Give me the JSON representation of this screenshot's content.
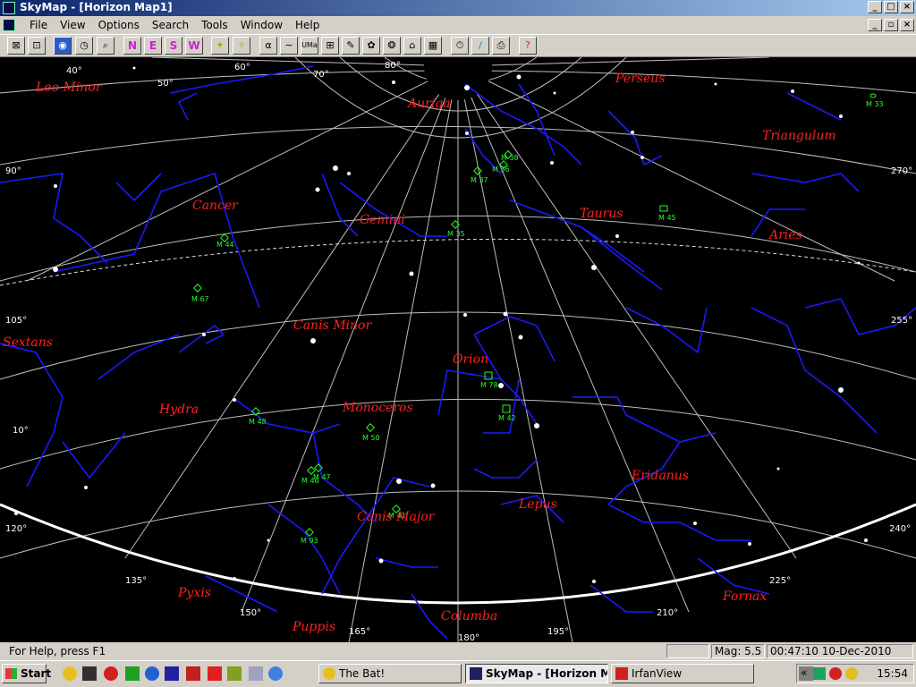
{
  "window": {
    "title": "SkyMap - [Horizon Map1]"
  },
  "menu": [
    "File",
    "View",
    "Options",
    "Search",
    "Tools",
    "Window",
    "Help"
  ],
  "toolbar": {
    "directions": [
      "N",
      "E",
      "S",
      "W"
    ],
    "alpha": "α",
    "umi": "UMa"
  },
  "sky": {
    "constellations": [
      {
        "name": "Leo Minor"
      },
      {
        "name": "Auriga"
      },
      {
        "name": "Perseus"
      },
      {
        "name": "Triangulum"
      },
      {
        "name": "Cancer"
      },
      {
        "name": "Gemini"
      },
      {
        "name": "Taurus"
      },
      {
        "name": "Aries"
      },
      {
        "name": "Canis Minor"
      },
      {
        "name": "Sextans"
      },
      {
        "name": "Orion"
      },
      {
        "name": "Hydra"
      },
      {
        "name": "Monoceros"
      },
      {
        "name": "Eridanus"
      },
      {
        "name": "Canis Major"
      },
      {
        "name": "Lepus"
      },
      {
        "name": "Pyxis"
      },
      {
        "name": "Puppis"
      },
      {
        "name": "Columba"
      },
      {
        "name": "Fornax"
      }
    ],
    "messier": [
      "M 33",
      "M 38",
      "M 36",
      "M 37",
      "M 45",
      "M 35",
      "M 44",
      "M 67",
      "M 78",
      "M 42",
      "M 48",
      "M 50",
      "M 46",
      "M 47",
      "M 41",
      "M 93"
    ],
    "azimuth_labels": [
      "40°",
      "50°",
      "60°",
      "70°",
      "80°",
      "90°",
      "270°",
      "105°",
      "255°",
      "10°",
      "120°",
      "240°",
      "135°",
      "225°",
      "150°",
      "210°",
      "165°",
      "180°",
      "195°"
    ]
  },
  "status": {
    "help": "For Help, press F1",
    "mag": "Mag: 5.5",
    "datetime": "00:47:10 10-Dec-2010"
  },
  "taskbar": {
    "start": "Start",
    "tasks": [
      "The Bat!",
      "SkyMap - [Horizon M...",
      "IrfanView"
    ],
    "tray_chevron": "«",
    "clock": "15:54"
  },
  "colors": {
    "constellation_lines": "#1a1aff",
    "constellation_names": "#ff2020",
    "messier": "#22ff22",
    "grid": "#cccccc",
    "title_bar": "#0a246a"
  }
}
